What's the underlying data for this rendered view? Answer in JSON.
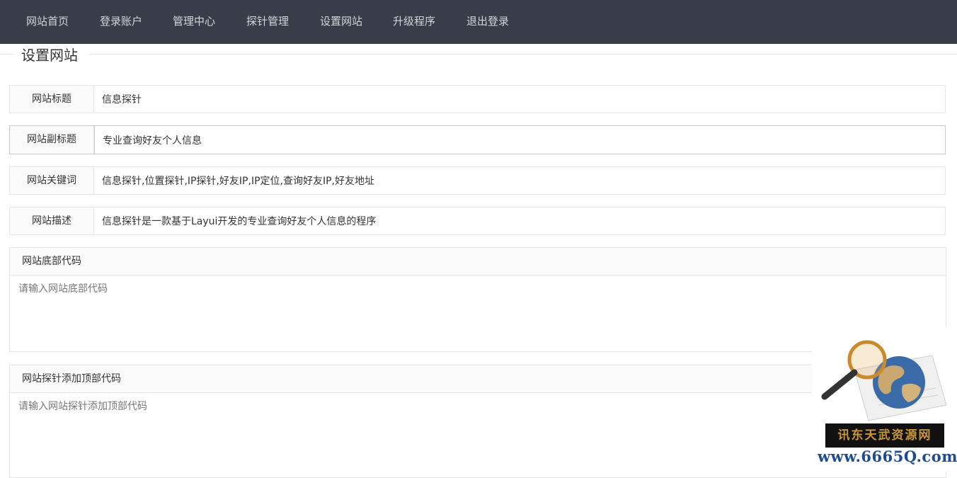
{
  "nav": {
    "items": [
      "网站首页",
      "登录账户",
      "管理中心",
      "探针管理",
      "设置网站",
      "升级程序",
      "退出登录"
    ]
  },
  "section": {
    "title": "设置网站"
  },
  "fields": [
    {
      "label": "网站标题",
      "value": "信息探针"
    },
    {
      "label": "网站副标题",
      "value": "专业查询好友个人信息"
    },
    {
      "label": "网站关键词",
      "value": "信息探针,位置探针,IP探针,好友IP,IP定位,查询好友IP,好友地址"
    },
    {
      "label": "网站描述",
      "value": "信息探针是一款基于Layui开发的专业查询好友个人信息的程序"
    }
  ],
  "footer_code": {
    "label": "网站底部代码",
    "placeholder": "请输入网站底部代码"
  },
  "probe_top_code": {
    "label": "网站探针添加顶部代码",
    "placeholder": "请输入网站探针添加顶部代码"
  },
  "watermark": {
    "badge": "讯东天武资源网",
    "url": "www.6665Q.com"
  }
}
